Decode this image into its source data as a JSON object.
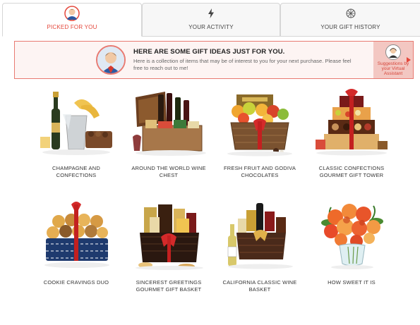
{
  "tabs": [
    {
      "label": "PICKED FOR YOU",
      "icon": "avatar-icon",
      "active": true
    },
    {
      "label": "YOUR ACTIVITY",
      "icon": "lightning-icon",
      "active": false
    },
    {
      "label": "YOUR GIFT HISTORY",
      "icon": "gift-icon",
      "active": false
    }
  ],
  "banner": {
    "title": "HERE ARE SOME GIFT IDEAS JUST FOR YOU.",
    "text": "Here is a collection of items that may be of interest to you for your next purchase. Please feel free to reach out to me!",
    "assistant_label": "Suggestions by your Virtual Assistant"
  },
  "products": [
    {
      "name": "CHAMPAGNE AND CONFECTIONS"
    },
    {
      "name": "AROUND THE WORLD WINE CHEST"
    },
    {
      "name": "FRESH FRUIT AND GODIVA CHOCOLATES"
    },
    {
      "name": "CLASSIC CONFECTIONS GOURMET GIFT TOWER"
    },
    {
      "name": "COOKIE CRAVINGS DUO"
    },
    {
      "name": "SINCEREST GREETINGS GOURMET GIFT BASKET"
    },
    {
      "name": "CALIFORNIA CLASSIC WINE BASKET"
    },
    {
      "name": "HOW SWEET IT IS"
    }
  ],
  "colors": {
    "accent": "#e4473b",
    "banner_border": "#e87a72",
    "banner_bg": "#fdf4f3",
    "assistant_bg": "#f3c7c2"
  }
}
